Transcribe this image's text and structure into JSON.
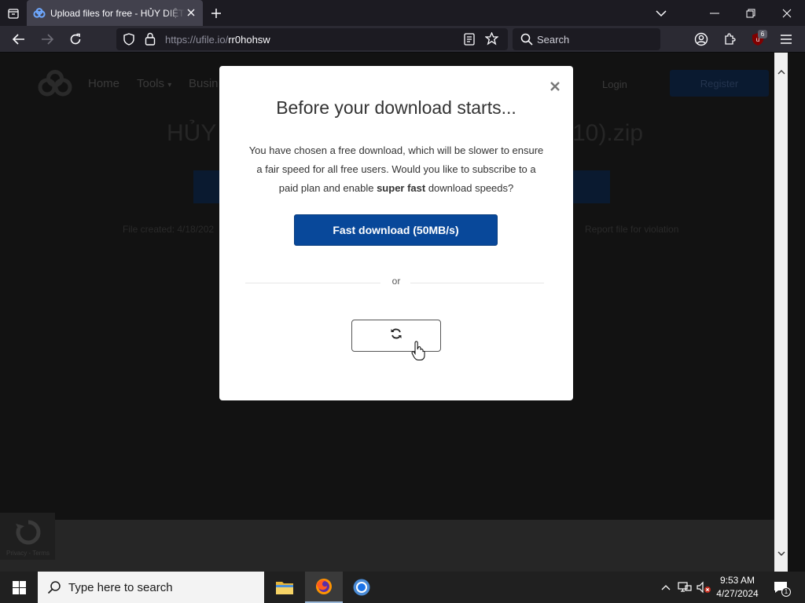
{
  "browser": {
    "tab_title": "Upload files for free - HỦY DIỆT K",
    "url_host": "https://ufile.io/",
    "url_path": "rr0hohsw",
    "search_placeholder": "Search",
    "extension_badge": "6"
  },
  "website": {
    "nav": [
      "Home",
      "Tools",
      "Busin"
    ],
    "login": "Login",
    "register": "Register",
    "file_title_left": "HỦY",
    "file_title_right": "10).zip",
    "file_created": "File created: 4/18/202",
    "report": "Report file for violation",
    "recaptcha_terms": "Privacy - Terms"
  },
  "modal": {
    "title": "Before your download starts...",
    "text_before_bold": "You have chosen a free download, which will be slower to ensure a fair speed for all free users. Would you like to subscribe to a paid plan and enable ",
    "text_bold": "super fast",
    "text_after_bold": " download speeds?",
    "fast_button": "Fast download (50MB/s)",
    "or": "or",
    "slow_button_icon": "refresh-icon"
  },
  "taskbar": {
    "search_placeholder": "Type here to search",
    "time": "9:53 AM",
    "date": "4/27/2024",
    "notification_count": "1"
  },
  "colors": {
    "primary_button": "#08489a",
    "browser_tab": "#42414d",
    "browser_toolbar": "#2b2a33"
  }
}
